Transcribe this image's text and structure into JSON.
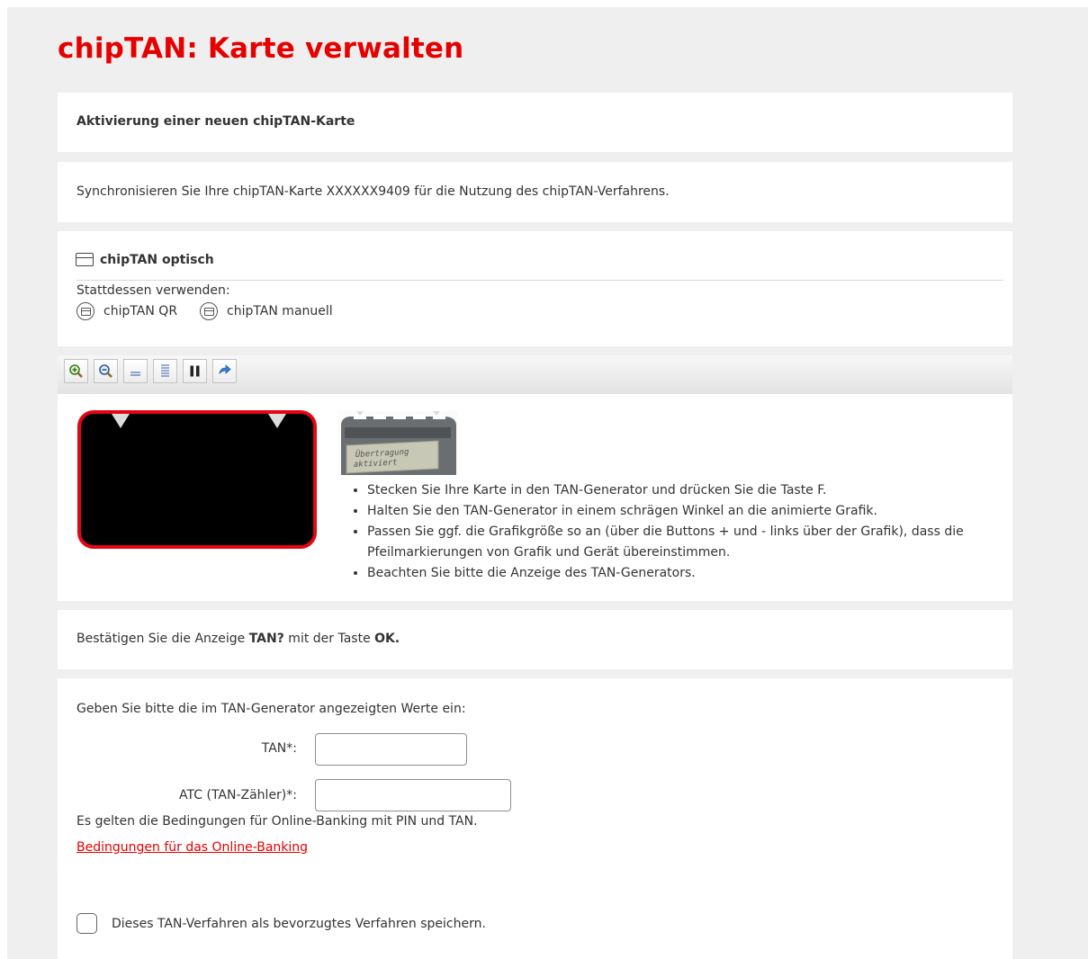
{
  "page": {
    "title": "chipTAN: Karte verwalten"
  },
  "activation": {
    "heading": "Aktivierung einer neuen chipTAN-Karte"
  },
  "sync": {
    "text": "Synchronisieren Sie Ihre chipTAN-Karte XXXXXX9409 für die Nutzung des chipTAN-Verfahrens."
  },
  "method": {
    "current": "chipTAN optisch",
    "alternatives_label": "Stattdessen verwenden:",
    "alternatives": [
      "chipTAN QR",
      "chipTAN manuell"
    ]
  },
  "toolbar": {
    "buttons": [
      {
        "icon": "zoom-in-icon"
      },
      {
        "icon": "zoom-out-icon"
      },
      {
        "icon": "speed-slower-icon"
      },
      {
        "icon": "speed-faster-icon"
      },
      {
        "icon": "pause-icon"
      },
      {
        "icon": "reset-icon"
      }
    ]
  },
  "device_display": {
    "line1": "Übertragung",
    "line2": "aktiviert"
  },
  "instructions": [
    "Stecken Sie Ihre Karte in den TAN-Generator und drücken Sie die Taste F.",
    "Halten Sie den TAN-Generator in einem schrägen Winkel an die animierte Grafik.",
    "Passen Sie ggf. die Grafikgröße so an (über die Buttons + und - links über der Grafik), dass die Pfeilmarkierungen von Grafik und Gerät übereinstimmen.",
    "Beachten Sie bitte die Anzeige des TAN-Generators."
  ],
  "confirm": {
    "prefix": "Bestätigen Sie die Anzeige ",
    "value": "TAN?",
    "middle": " mit der Taste ",
    "key": "OK."
  },
  "form": {
    "intro": "Geben Sie bitte die im TAN-Generator angezeigten Werte ein:",
    "tan_label": "TAN*:",
    "tan_value": "",
    "atc_label": "ATC (TAN-Zähler)*:",
    "atc_value": "",
    "conditions": "Es gelten die Bedingungen für Online-Banking mit PIN und TAN.",
    "conditions_link": "Bedingungen für das Online-Banking",
    "save_preference": "Dieses TAN-Verfahren als bevorzugtes Verfahren speichern.",
    "save_checked": false
  },
  "colors": {
    "brand_red": "#e60000",
    "frame_red": "#e30613",
    "background": "#efefef"
  }
}
